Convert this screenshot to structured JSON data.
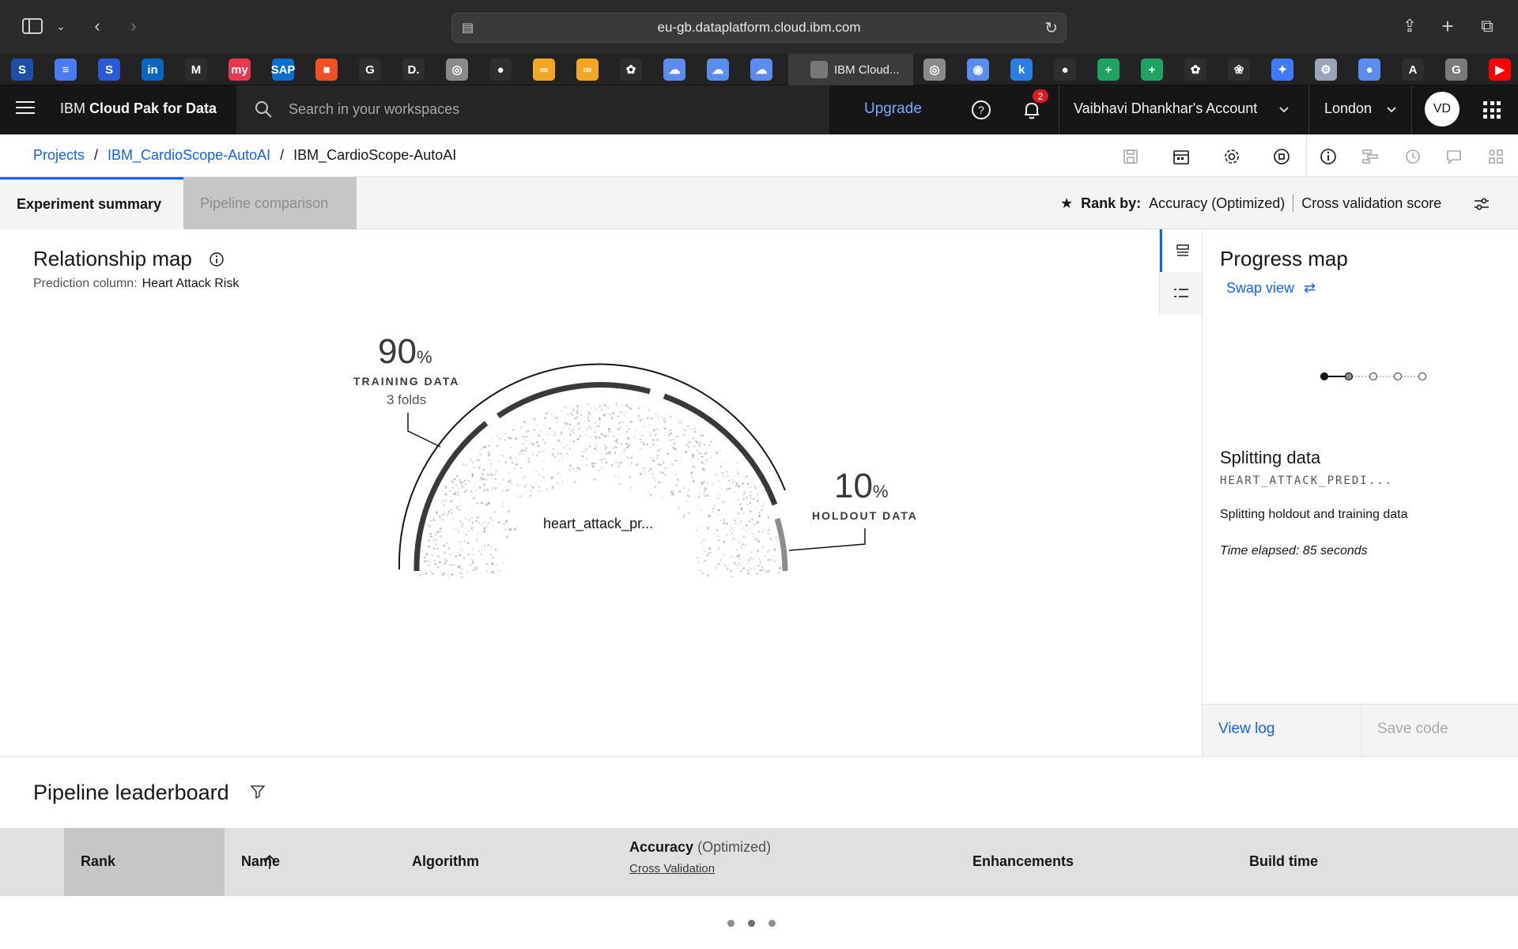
{
  "browser": {
    "url": "eu-gb.dataplatform.cloud.ibm.com",
    "active_tab_label": "IBM Cloud...",
    "bookmarks": [
      {
        "icon": "s-blue-icon",
        "color": "#1f4ea8",
        "glyph": "S"
      },
      {
        "icon": "docs-icon",
        "color": "#4a7bf7",
        "glyph": "≡"
      },
      {
        "icon": "s-blue-icon",
        "color": "#2a5bd7",
        "glyph": "S"
      },
      {
        "icon": "linkedin-icon",
        "color": "#0a66c2",
        "glyph": "in"
      },
      {
        "icon": "gmail-icon",
        "color": "#ffffff",
        "glyph": "M"
      },
      {
        "icon": "myntra-icon",
        "color": "#e8384f",
        "glyph": "my"
      },
      {
        "icon": "sap-icon",
        "color": "#0a6ed1",
        "glyph": "SAP"
      },
      {
        "icon": "microsoft-icon",
        "color": "#f25022",
        "glyph": "■"
      },
      {
        "icon": "google-icon",
        "color": "#ffffff",
        "glyph": "G"
      },
      {
        "icon": "d-icon",
        "color": "#ffffff",
        "glyph": "D."
      },
      {
        "icon": "ibm-cloud-icon",
        "color": "#8a8a8a",
        "glyph": "◎"
      },
      {
        "icon": "github-icon",
        "color": "#ffffff",
        "glyph": "●"
      },
      {
        "icon": "infinity-icon",
        "color": "#f5a623",
        "glyph": "∞"
      },
      {
        "icon": "infinity-icon",
        "color": "#f5a623",
        "glyph": "∞"
      },
      {
        "icon": "openai-icon",
        "color": "#ffffff",
        "glyph": "✿"
      },
      {
        "icon": "cloud-icon",
        "color": "#5b8def",
        "glyph": "☁"
      },
      {
        "icon": "cloud-icon",
        "color": "#5b8def",
        "glyph": "☁"
      },
      {
        "icon": "cloud-icon",
        "color": "#5b8def",
        "glyph": "☁"
      }
    ],
    "bookmarks_right": [
      {
        "icon": "ibm-cloud-icon",
        "color": "#8a8a8a",
        "glyph": "◎"
      },
      {
        "icon": "globe-icon",
        "color": "#5b8def",
        "glyph": "◉"
      },
      {
        "icon": "k-icon",
        "color": "#2a7de1",
        "glyph": "k"
      },
      {
        "icon": "github-icon",
        "color": "#ffffff",
        "glyph": "●"
      },
      {
        "icon": "sheets-icon",
        "color": "#1ea362",
        "glyph": "+"
      },
      {
        "icon": "sheets-icon",
        "color": "#1ea362",
        "glyph": "+"
      },
      {
        "icon": "openai-icon",
        "color": "#ffffff",
        "glyph": "✿"
      },
      {
        "icon": "flower-icon",
        "color": "#ffffff",
        "glyph": "❀"
      },
      {
        "icon": "butterfly-icon",
        "color": "#3e7bff",
        "glyph": "✦"
      },
      {
        "icon": "tools-icon",
        "color": "#9aa4b8",
        "glyph": "⚙"
      },
      {
        "icon": "circle-icon",
        "color": "#5b8def",
        "glyph": "●"
      },
      {
        "icon": "app-icon",
        "color": "#ffffff",
        "glyph": "A"
      },
      {
        "icon": "g-icon",
        "color": "#7a7a7a",
        "glyph": "G"
      },
      {
        "icon": "youtube-icon",
        "color": "#ff0000",
        "glyph": "▶"
      }
    ]
  },
  "header": {
    "brand_prefix": "IBM",
    "brand_name": "Cloud Pak for Data",
    "search_placeholder": "Search in your workspaces",
    "upgrade": "Upgrade",
    "notifications_count": "2",
    "account": "Vaibhavi Dhankhar's Account",
    "region": "London",
    "avatar_initials": "VD"
  },
  "breadcrumb": {
    "items": [
      "Projects",
      "IBM_CardioScope-AutoAI"
    ],
    "current": "IBM_CardioScope-AutoAI",
    "separator": "/"
  },
  "tabs": {
    "experiment_summary": "Experiment summary",
    "pipeline_comparison": "Pipeline comparison"
  },
  "rank_by": {
    "label": "Rank by:",
    "metric": "Accuracy (Optimized)",
    "score_type": "Cross validation score"
  },
  "relationship_map": {
    "title": "Relationship map",
    "prediction_label": "Prediction column:",
    "prediction_value": "Heart Attack Risk",
    "training_percent": "90",
    "training_label": "TRAINING DATA",
    "training_folds": "3 folds",
    "holdout_percent": "10",
    "holdout_label": "HOLDOUT DATA",
    "percent_sign": "%",
    "dataset_name": "heart_attack_pr..."
  },
  "progress_map": {
    "title": "Progress map",
    "swap_view": "Swap view",
    "stages_total": 5,
    "stages_complete": 2,
    "step_title": "Splitting data",
    "step_code": "HEART_ATTACK_PREDI...",
    "step_description": "Splitting holdout and training data",
    "time_elapsed": "Time elapsed: 85 seconds",
    "view_log": "View log",
    "save_code": "Save code"
  },
  "leaderboard": {
    "title": "Pipeline leaderboard",
    "columns": {
      "rank": "Rank",
      "name": "Name",
      "algorithm": "Algorithm",
      "accuracy": "Accuracy",
      "accuracy_suffix": "(Optimized)",
      "accuracy_sub": "Cross Validation",
      "enhancements": "Enhancements",
      "build_time": "Build time"
    }
  }
}
